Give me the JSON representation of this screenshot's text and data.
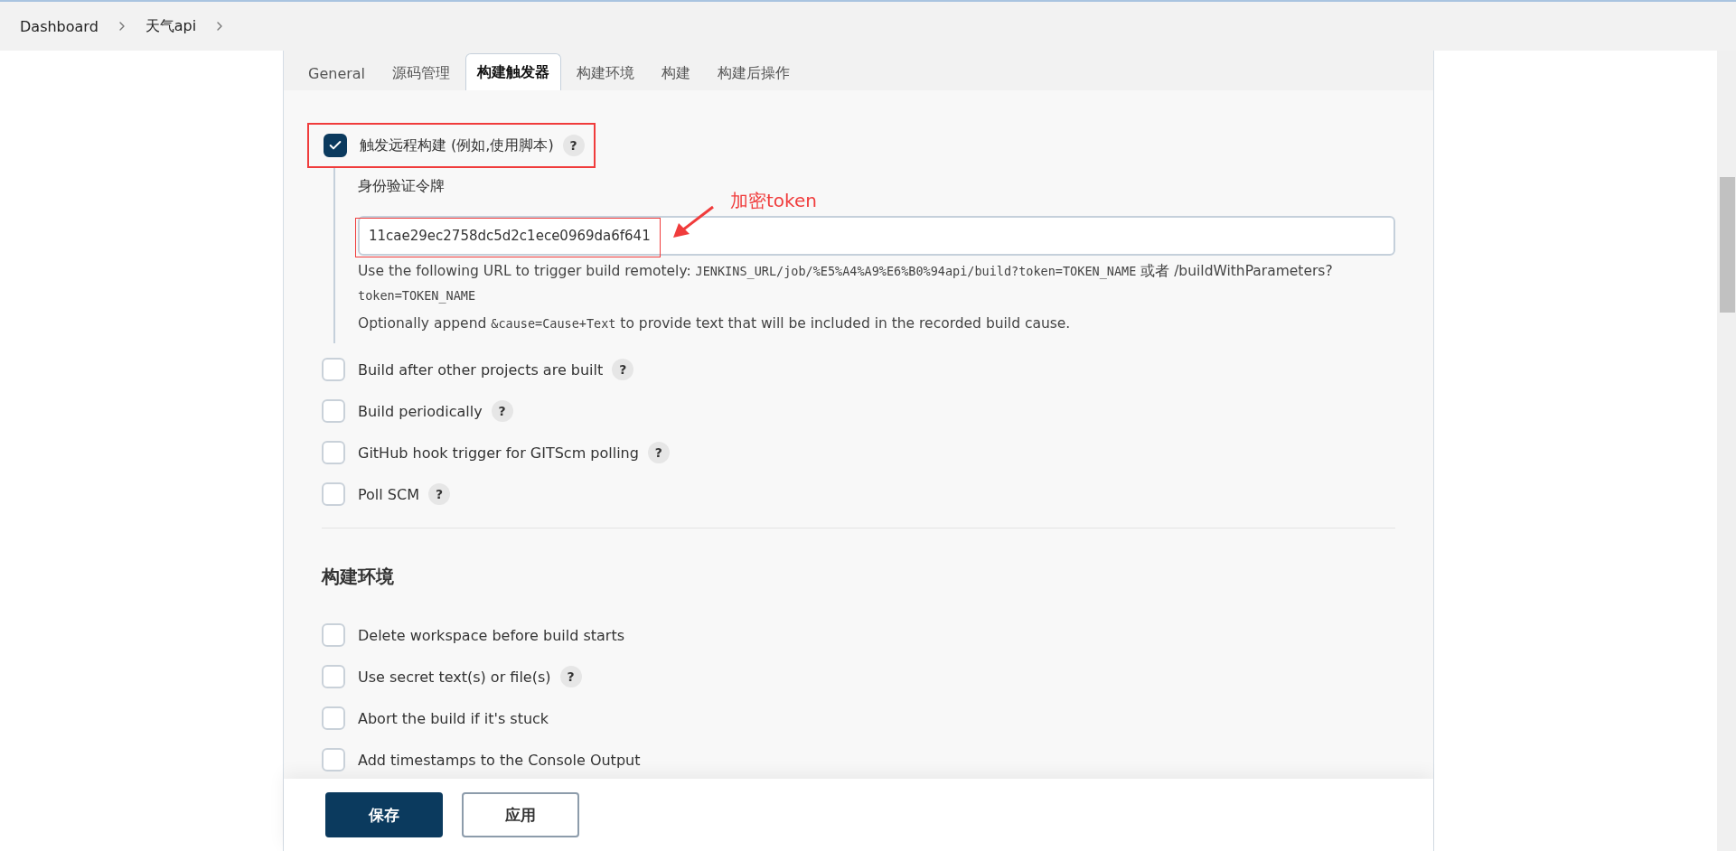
{
  "breadcrumbs": [
    {
      "label": "Dashboard"
    },
    {
      "label": "天气api"
    }
  ],
  "tabs": [
    {
      "label": "General",
      "selected": false
    },
    {
      "label": "源码管理",
      "selected": false
    },
    {
      "label": "构建触发器",
      "selected": true
    },
    {
      "label": "构建环境",
      "selected": false
    },
    {
      "label": "构建",
      "selected": false
    },
    {
      "label": "构建后操作",
      "selected": false
    }
  ],
  "remote_trigger": {
    "label": "触发远程构建 (例如,使用脚本)",
    "checked": true,
    "help": "?",
    "highlighted": true,
    "token_label": "身份验证令牌",
    "token_value": "11cae29ec2758dc5d2c1ece0969da6f641",
    "token_highlighted": true,
    "annotation": "加密token",
    "help_paragraphs": [
      [
        {
          "kind": "text",
          "text": "Use the following URL to trigger build remotely: "
        },
        {
          "kind": "code",
          "text": "JENKINS_URL/job/%E5%A4%A9%E6%B0%94api/build?token=TOKEN_NAME"
        },
        {
          "kind": "text",
          "text": " 或者 /buildWithParameters?"
        },
        {
          "kind": "code",
          "text": "token=TOKEN_NAME"
        }
      ],
      [
        {
          "kind": "text",
          "text": "Optionally append "
        },
        {
          "kind": "code",
          "text": "&cause=Cause+Text"
        },
        {
          "kind": "text",
          "text": " to provide text that will be included in the recorded build cause."
        }
      ]
    ]
  },
  "triggers": [
    {
      "label": "Build after other projects are built",
      "checked": false,
      "help": "?"
    },
    {
      "label": "Build periodically",
      "checked": false,
      "help": "?"
    },
    {
      "label": "GitHub hook trigger for GITScm polling",
      "checked": false,
      "help": "?"
    },
    {
      "label": "Poll SCM",
      "checked": false,
      "help": "?"
    }
  ],
  "build_environment": {
    "heading": "构建环境",
    "items": [
      {
        "label": "Delete workspace before build starts",
        "checked": false
      },
      {
        "label": "Use secret text(s) or file(s)",
        "checked": false,
        "help": "?"
      },
      {
        "label": "Abort the build if it's stuck",
        "checked": false
      },
      {
        "label": "Add timestamps to the Console Output",
        "checked": false
      }
    ]
  },
  "buttons": [
    {
      "label": "保存",
      "kind": "primary"
    },
    {
      "label": "应用",
      "kind": "secondary"
    }
  ]
}
